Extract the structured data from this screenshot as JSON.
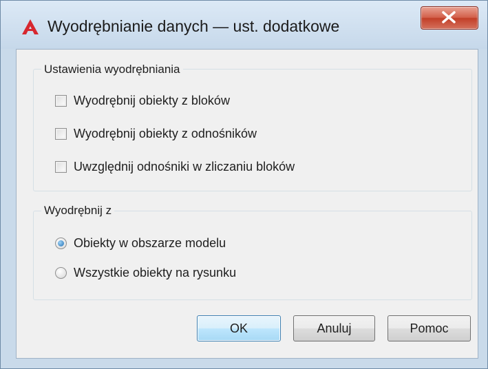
{
  "dialog": {
    "title": "Wyodrębnianie danych — ust. dodatkowe"
  },
  "extraction_settings": {
    "group_title": "Ustawienia wyodrębniania",
    "options": [
      {
        "label": "Wyodrębnij obiekty z bloków",
        "checked": false
      },
      {
        "label": "Wyodrębnij obiekty z odnośników",
        "checked": false
      },
      {
        "label": "Uwzględnij odnośniki w zliczaniu bloków",
        "checked": false
      }
    ]
  },
  "extract_from": {
    "group_title": "Wyodrębnij z",
    "options": [
      {
        "label": "Obiekty w obszarze modelu",
        "selected": true
      },
      {
        "label": "Wszystkie obiekty na rysunku",
        "selected": false
      }
    ]
  },
  "buttons": {
    "ok": "OK",
    "cancel": "Anuluj",
    "help": "Pomoc"
  },
  "icons": {
    "app": "autocad-triangle-icon",
    "close": "close-icon"
  },
  "colors": {
    "app_icon": "#d7272f",
    "close_button": "#c94a35",
    "default_button_border": "#3c7fb1"
  }
}
